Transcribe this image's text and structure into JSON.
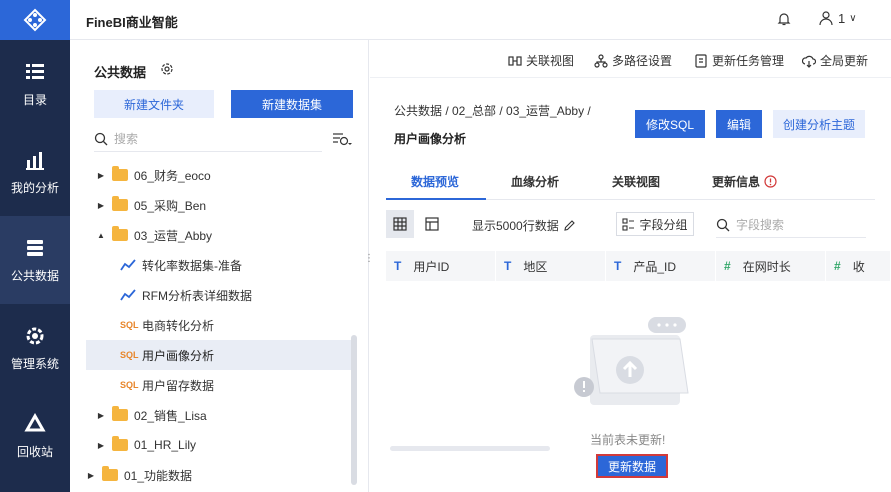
{
  "app": {
    "name": "FineBI商业智能",
    "user_count": "1"
  },
  "nav": {
    "items": [
      {
        "label": "目录",
        "icon": "catalog-icon"
      },
      {
        "label": "我的分析",
        "icon": "chart-icon"
      },
      {
        "label": "公共数据",
        "icon": "database-icon"
      },
      {
        "label": "管理系统",
        "icon": "settings-icon"
      },
      {
        "label": "回收站",
        "icon": "recycle-icon"
      }
    ]
  },
  "sidebar": {
    "title": "公共数据",
    "new_folder": "新建文件夹",
    "new_dataset": "新建数据集",
    "search_placeholder": "搜索",
    "tree": [
      {
        "label": "06_财务_eoco",
        "type": "folder"
      },
      {
        "label": "05_采购_Ben",
        "type": "folder"
      },
      {
        "label": "03_运营_Abby",
        "type": "folder-open"
      },
      {
        "label": "转化率数据集-准备",
        "type": "dataset"
      },
      {
        "label": "RFM分析表详细数据",
        "type": "dataset"
      },
      {
        "label": "电商转化分析",
        "type": "sql"
      },
      {
        "label": "用户画像分析",
        "type": "sql"
      },
      {
        "label": "用户留存数据",
        "type": "sql"
      },
      {
        "label": "02_销售_Lisa",
        "type": "folder"
      },
      {
        "label": "01_HR_Lily",
        "type": "folder"
      },
      {
        "label": "01_功能数据",
        "type": "folder"
      }
    ]
  },
  "toolbar": {
    "relation_view": "关联视图",
    "multipath": "多路径设置",
    "update_task": "更新任务管理",
    "global_update": "全局更新"
  },
  "main": {
    "breadcrumb": "公共数据  /  02_总部  /  03_运营_Abby  /",
    "current": "用户画像分析",
    "btn_edit_sql": "修改SQL",
    "btn_edit": "编辑",
    "btn_create_subject": "创建分析主题",
    "tabs": [
      "数据预览",
      "血缘分析",
      "关联视图",
      "更新信息"
    ],
    "row_limit": "显示5000行数据",
    "field_group": "字段分组",
    "field_search_placeholder": "字段搜索",
    "columns": [
      {
        "type": "T",
        "name": "用户ID"
      },
      {
        "type": "T",
        "name": "地区"
      },
      {
        "type": "T",
        "name": "产品_ID"
      },
      {
        "type": "#",
        "name": "在网时长"
      },
      {
        "type": "#",
        "name": "收"
      }
    ],
    "empty_text": "当前表未更新!",
    "btn_update": "更新数据"
  }
}
